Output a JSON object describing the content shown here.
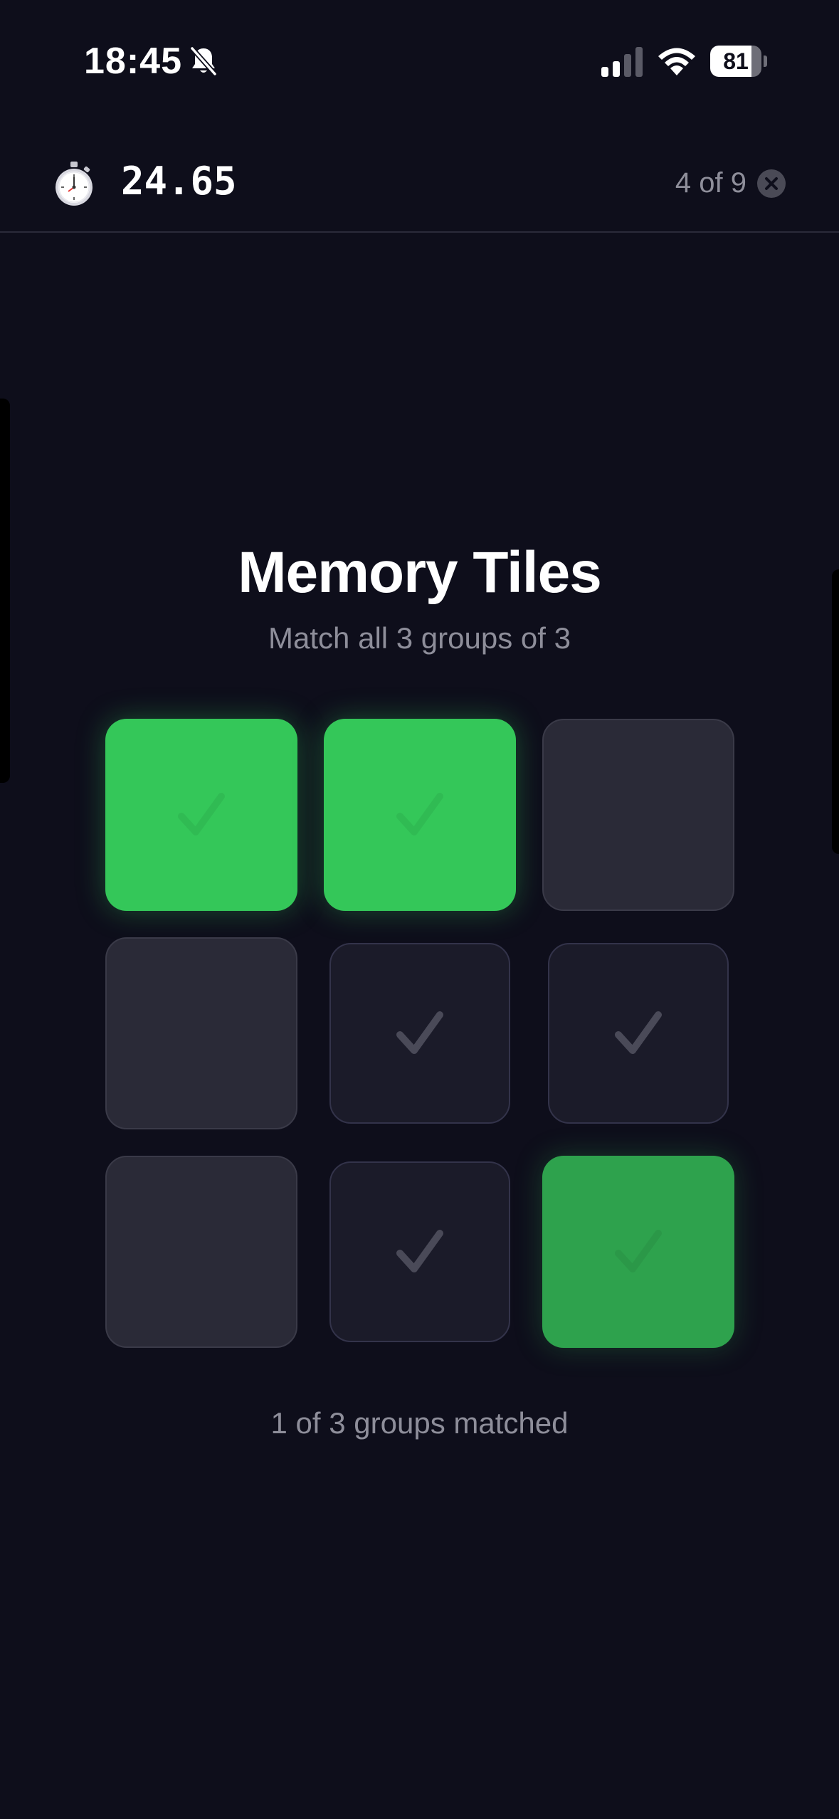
{
  "status_bar": {
    "time": "18:45",
    "battery_level": "81",
    "battery_fraction": 0.81,
    "icons": [
      "bell-slash-icon",
      "cellular-signal-icon",
      "wifi-icon",
      "battery-icon"
    ]
  },
  "header": {
    "timer": "24.65",
    "progress": "4 of 9",
    "icons": [
      "stopwatch-icon",
      "close-icon"
    ]
  },
  "game": {
    "title": "Memory Tiles",
    "subtitle": "Match all 3 groups of 3",
    "status": "1 of 3 groups matched",
    "tiles": [
      {
        "row": 1,
        "col": 1,
        "state": "revealed"
      },
      {
        "row": 1,
        "col": 2,
        "state": "revealed"
      },
      {
        "row": 1,
        "col": 3,
        "state": "hidden"
      },
      {
        "row": 2,
        "col": 1,
        "state": "hidden"
      },
      {
        "row": 2,
        "col": 2,
        "state": "matched"
      },
      {
        "row": 2,
        "col": 3,
        "state": "matched"
      },
      {
        "row": 3,
        "col": 1,
        "state": "hidden"
      },
      {
        "row": 3,
        "col": 2,
        "state": "matched"
      },
      {
        "row": 3,
        "col": 3,
        "state": "revealed"
      }
    ]
  },
  "colors": {
    "background": "#0e0e1b",
    "revealed_tile": "#34c759",
    "hidden_tile": "#2a2a37",
    "matched_tile": "#1b1b29",
    "secondary_text": "#8e8e9a"
  }
}
